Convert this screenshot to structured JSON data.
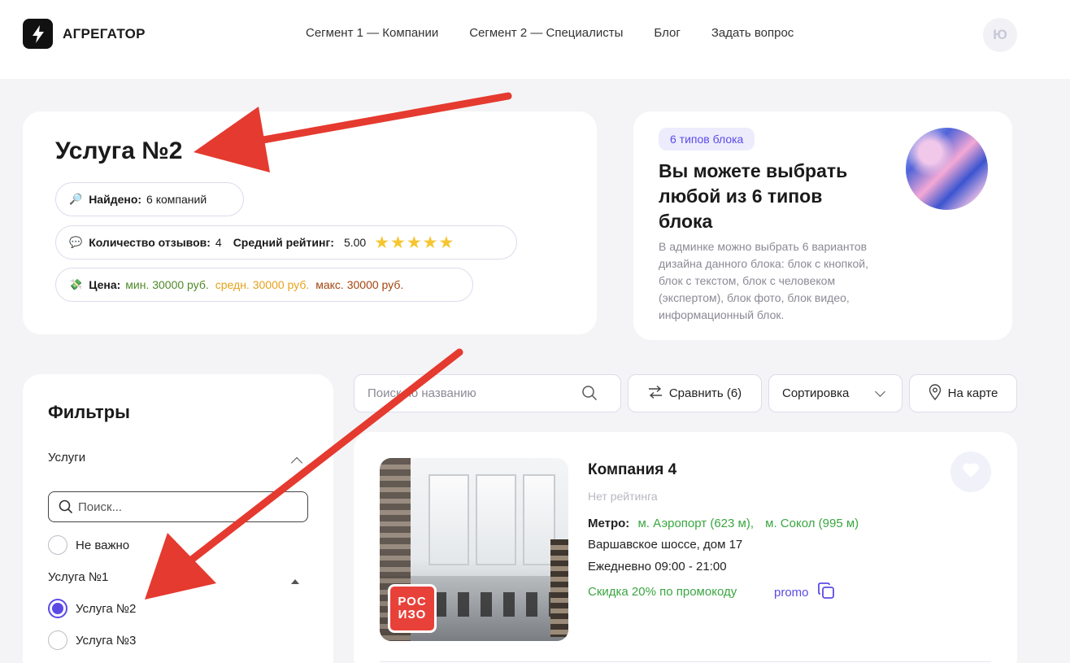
{
  "header": {
    "logo_text": "АГРЕГАТОР",
    "nav": [
      "Сегмент 1 — Компании",
      "Сегмент 2 — Специалисты",
      "Блог",
      "Задать вопрос"
    ],
    "avatar_initial": "Ю"
  },
  "service": {
    "title": "Услуга №2",
    "found_label": "Найдено:",
    "found_value": "6 компаний",
    "reviews_label": "Количество отзывов:",
    "reviews_value": "4",
    "rating_label": "Средний рейтинг:",
    "rating_value": "5.00",
    "stars": 5,
    "price_label": "Цена:",
    "price_min": "мин. 30000 руб.",
    "price_avg": "средн. 30000 руб.",
    "price_max": "макс. 30000 руб.",
    "icons": {
      "found": "magnifier-emoji",
      "reviews": "speech-bubble-emoji",
      "price": "money-emoji"
    }
  },
  "info_block": {
    "tag": "6 типов блока",
    "title": "Вы можете выбрать любой из 6 типов блока",
    "text": "В админке можно выбрать 6 вариантов дизайна данного блока: блок с кнопкой, блок с текстом, блок с человеком (экспертом), блок фото, блок видео, информационный блок."
  },
  "filters": {
    "title": "Фильтры",
    "section_label": "Услуги",
    "search_placeholder": "Поиск...",
    "options": [
      {
        "label": "Не важно",
        "selected": false
      },
      {
        "label": "Услуга №1",
        "group": true
      },
      {
        "label": "Услуга №2",
        "selected": true
      },
      {
        "label": "Услуга №3",
        "selected": false
      }
    ]
  },
  "toolbar": {
    "search_placeholder": "Поиск по названию",
    "compare_label": "Сравнить (6)",
    "sort_label": "Сортировка",
    "map_label": "На карте"
  },
  "company": {
    "name": "Компания 4",
    "rating": "Нет рейтинга",
    "metro_label": "Метро:",
    "metro_1": "м. Аэропорт (623 м),",
    "metro_2": "м. Сокол (995 м)",
    "address": "Варшавское шоссе, дом 17",
    "hours": "Ежедневно 09:00 - 21:00",
    "discount": "Скидка 20% по промокоду",
    "promo": "promo",
    "badge_line1": "РОС",
    "badge_line2": "ИЗО"
  },
  "colors": {
    "accent": "#5b4be6",
    "green": "#3aa641",
    "price_min": "#4e8a28",
    "price_avg": "#e7a21b",
    "price_max": "#a4440e",
    "star": "#f6c630",
    "arrow": "#e53a2f"
  }
}
